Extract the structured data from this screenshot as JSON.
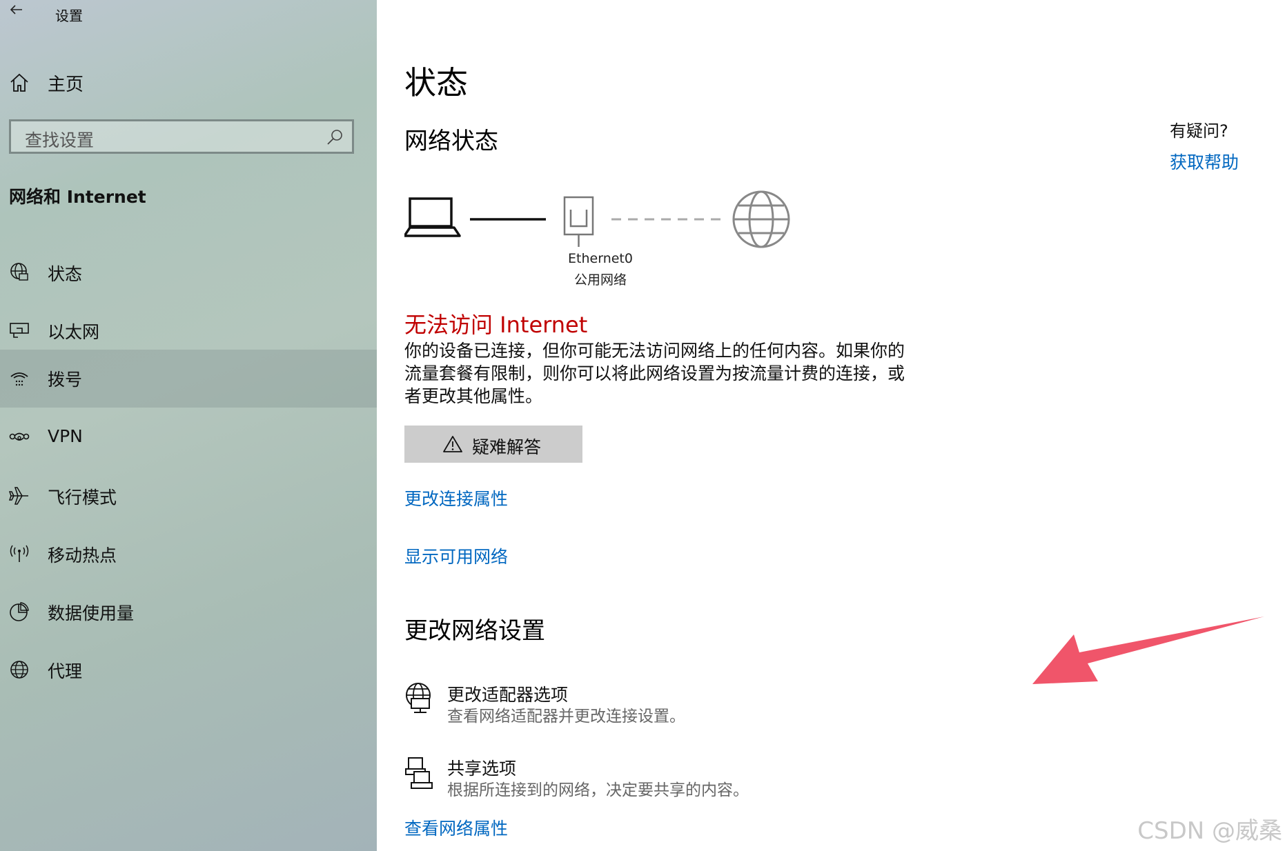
{
  "window": {
    "title": "设置"
  },
  "sidebar": {
    "home_label": "主页",
    "search_placeholder": "查找设置",
    "section_title": "网络和 Internet",
    "items": [
      {
        "label": "状态",
        "icon": "globe-status-icon"
      },
      {
        "label": "以太网",
        "icon": "ethernet-icon"
      },
      {
        "label": "拨号",
        "icon": "dialup-icon",
        "selected": true
      },
      {
        "label": "VPN",
        "icon": "vpn-icon"
      },
      {
        "label": "飞行模式",
        "icon": "airplane-icon"
      },
      {
        "label": "移动热点",
        "icon": "hotspot-icon"
      },
      {
        "label": "数据使用量",
        "icon": "data-usage-icon"
      },
      {
        "label": "代理",
        "icon": "globe-icon"
      }
    ]
  },
  "main": {
    "title": "状态",
    "network_status_heading": "网络状态",
    "adapter": {
      "name": "Ethernet0",
      "type": "公用网络"
    },
    "error_title": "无法访问 Internet",
    "error_desc": "你的设备已连接，但你可能无法访问网络上的任何内容。如果你的流量套餐有限制，则你可以将此网络设置为按流量计费的连接，或者更改其他属性。",
    "troubleshoot_label": "疑难解答",
    "link_change_connection": "更改连接属性",
    "link_show_networks": "显示可用网络",
    "change_settings_heading": "更改网络设置",
    "options": [
      {
        "title": "更改适配器选项",
        "subtitle": "查看网络适配器并更改连接设置。",
        "icon": "adapter-globe-icon"
      },
      {
        "title": "共享选项",
        "subtitle": "根据所连接到的网络，决定要共享的内容。",
        "icon": "sharing-icon"
      }
    ],
    "link_view_properties": "查看网络属性"
  },
  "help": {
    "question": "有疑问?",
    "link": "获取帮助"
  },
  "watermark": "CSDN @威桑",
  "colors": {
    "accent": "#0067c0",
    "error": "#c00000",
    "arrow": "#f0556a"
  }
}
